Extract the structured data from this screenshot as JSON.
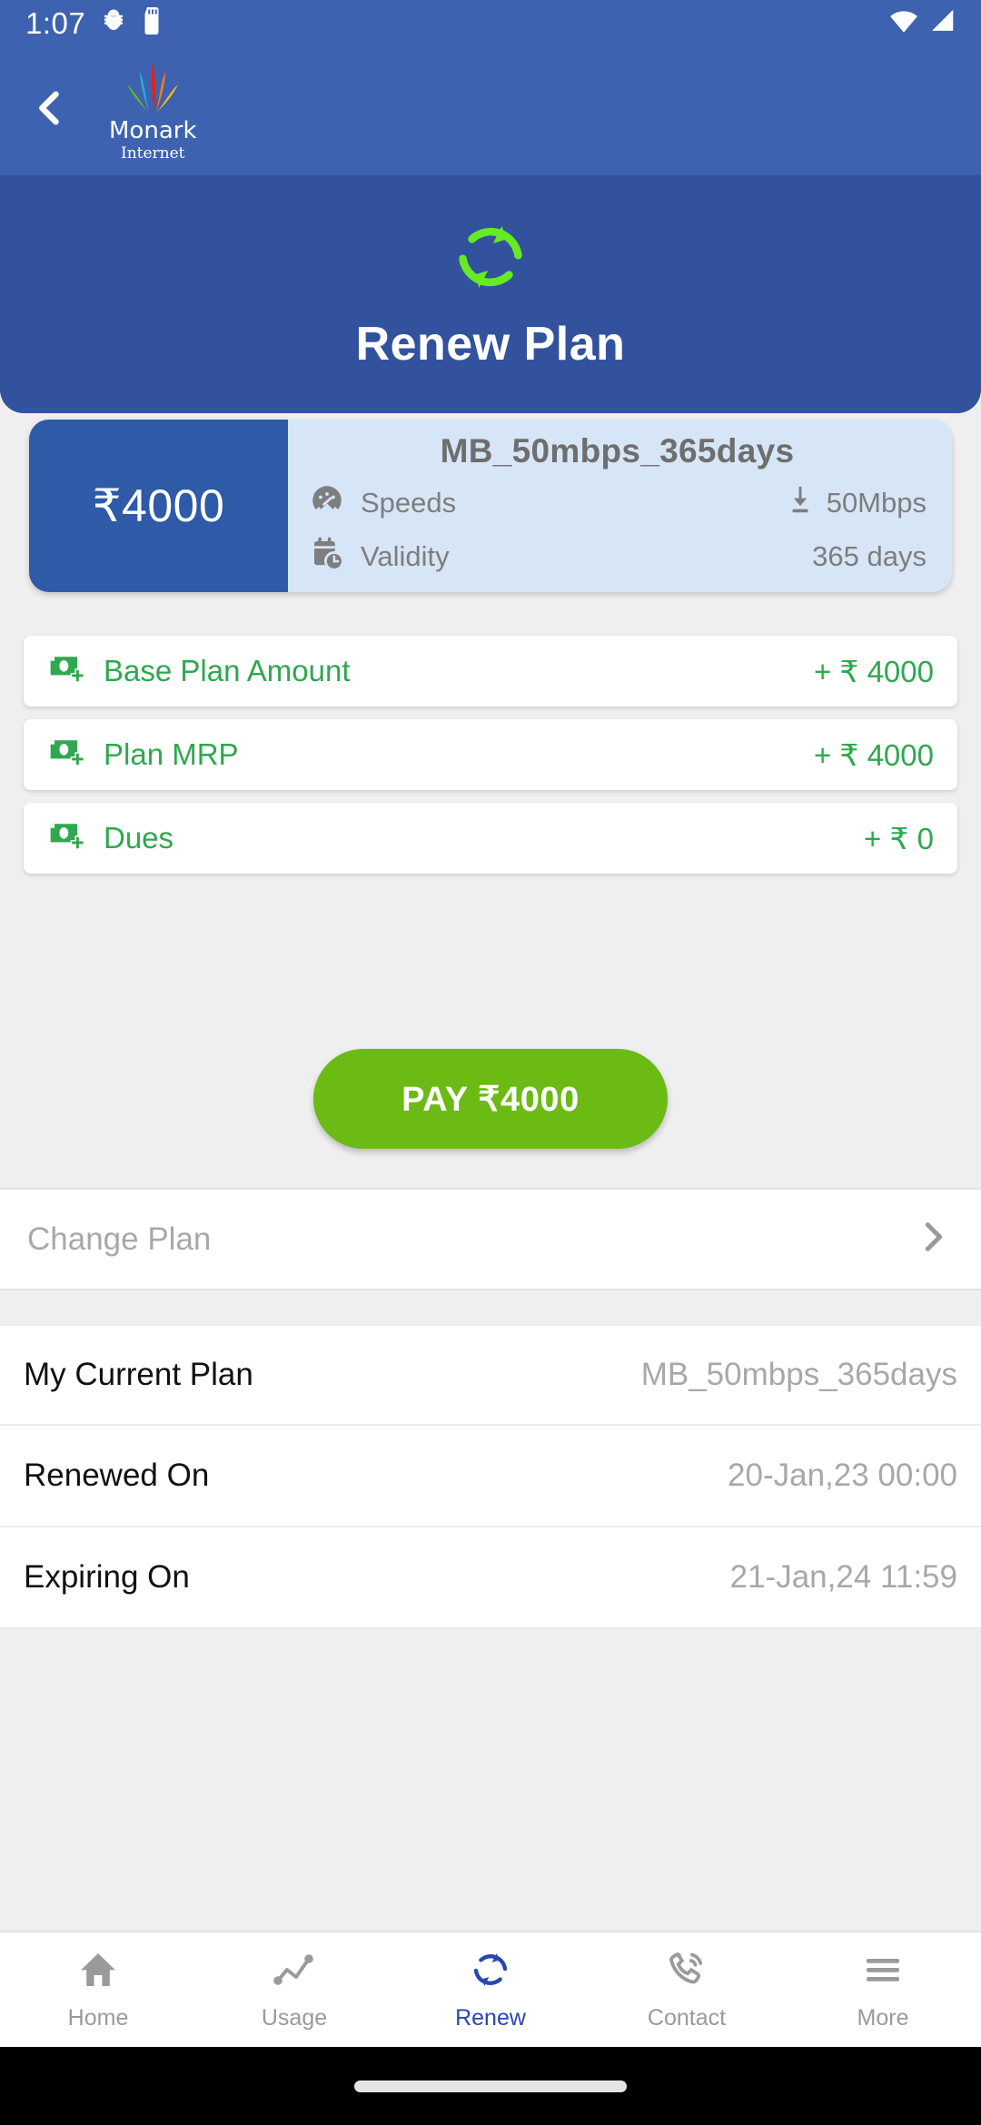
{
  "status_bar": {
    "time": "1:07",
    "icons": [
      "android-bug-icon",
      "sd-card-icon",
      "wifi-icon",
      "cellular-signal-icon"
    ]
  },
  "app_bar": {
    "back_icon": "chevron-left-icon",
    "logo_name": "Monark",
    "logo_sub": "Internet"
  },
  "hero": {
    "icon": "refresh-icon",
    "title": "Renew Plan",
    "background_color": "#32529E",
    "icon_color": "#66EB22"
  },
  "plan_card": {
    "price": "₹4000",
    "name": "MB_50mbps_365days",
    "rows": [
      {
        "icon": "speedometer-icon",
        "label": "Speeds",
        "value_icon": "download-icon",
        "value": "50Mbps"
      },
      {
        "icon": "calendar-clock-icon",
        "label": "Validity",
        "value_icon": "",
        "value": "365 days"
      }
    ]
  },
  "breakdown": {
    "rows": [
      {
        "icon": "money-plus-icon",
        "label": "Base Plan Amount",
        "amount": "+ ₹ 4000"
      },
      {
        "icon": "money-plus-icon",
        "label": "Plan MRP",
        "amount": "+ ₹ 4000"
      },
      {
        "icon": "money-plus-icon",
        "label": "Dues",
        "amount": "+ ₹ 0"
      }
    ]
  },
  "pay_button": {
    "label": "PAY ₹4000",
    "color": "#6CBA14"
  },
  "change_plan": {
    "label": "Change Plan",
    "chevron_icon": "chevron-right-icon"
  },
  "info_list": {
    "rows": [
      {
        "key": "My Current Plan",
        "value": "MB_50mbps_365days"
      },
      {
        "key": "Renewed On",
        "value": "20-Jan,23 00:00"
      },
      {
        "key": "Expiring On",
        "value": "21-Jan,24 11:59"
      }
    ]
  },
  "bottom_nav": {
    "active_index": 2,
    "active_color": "#2B46B0",
    "items": [
      {
        "icon": "home-icon",
        "label": "Home"
      },
      {
        "icon": "usage-chart-icon",
        "label": "Usage"
      },
      {
        "icon": "refresh-icon",
        "label": "Renew"
      },
      {
        "icon": "phone-ring-icon",
        "label": "Contact"
      },
      {
        "icon": "hamburger-menu-icon",
        "label": "More"
      }
    ]
  }
}
